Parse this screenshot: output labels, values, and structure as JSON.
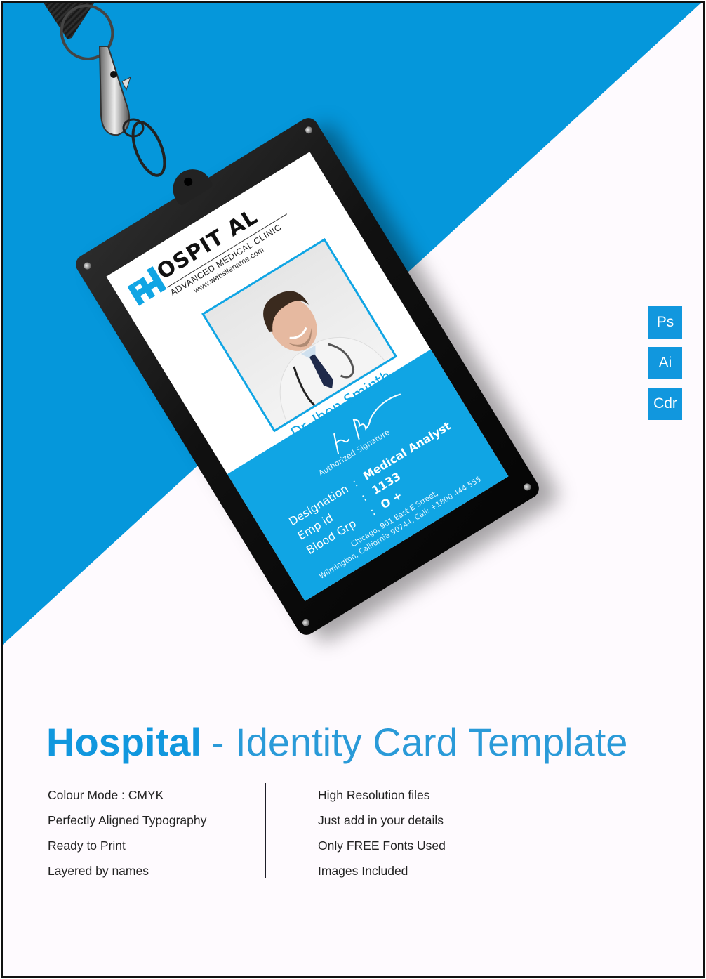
{
  "colors": {
    "brand_blue": "#1197de",
    "card_blue": "#10a5e4",
    "holder_black": "#111111",
    "page_bg": "#fefafe"
  },
  "id_card": {
    "logo": {
      "icon": "hospital-h-logo-icon",
      "title": "OSPIT AL",
      "subtitle": "ADVANCED MEDICAL CLINIC",
      "website": "www.websitename.com"
    },
    "photo": "doctor-portrait-photo",
    "name": "Dr. Jhon Sminth",
    "signature_label": "Authorized Signature",
    "fields": [
      {
        "label": "Designation",
        "separator": ":",
        "value": "Medical Analyst"
      },
      {
        "label": "Emp id",
        "separator": ":",
        "value": "1133"
      },
      {
        "label": "Blood Grp",
        "separator": ":",
        "value": "O +"
      }
    ],
    "address_line1": "Chicago, 901 East E Street,",
    "address_line2": "Wilmington, California 90744,  Call: +1800 444 555"
  },
  "file_badges": [
    {
      "label": "Ps"
    },
    {
      "label": "Ai"
    },
    {
      "label": "Cdr"
    }
  ],
  "headline": {
    "bold": "Hospital",
    "rest": "- Identity Card Template"
  },
  "features_left": [
    "Colour Mode : CMYK",
    "Perfectly Aligned Typography",
    "Ready to Print",
    "Layered by names"
  ],
  "features_right": [
    "High Resolution files",
    "Just add in your details",
    "Only FREE Fonts Used",
    "Images Included"
  ]
}
